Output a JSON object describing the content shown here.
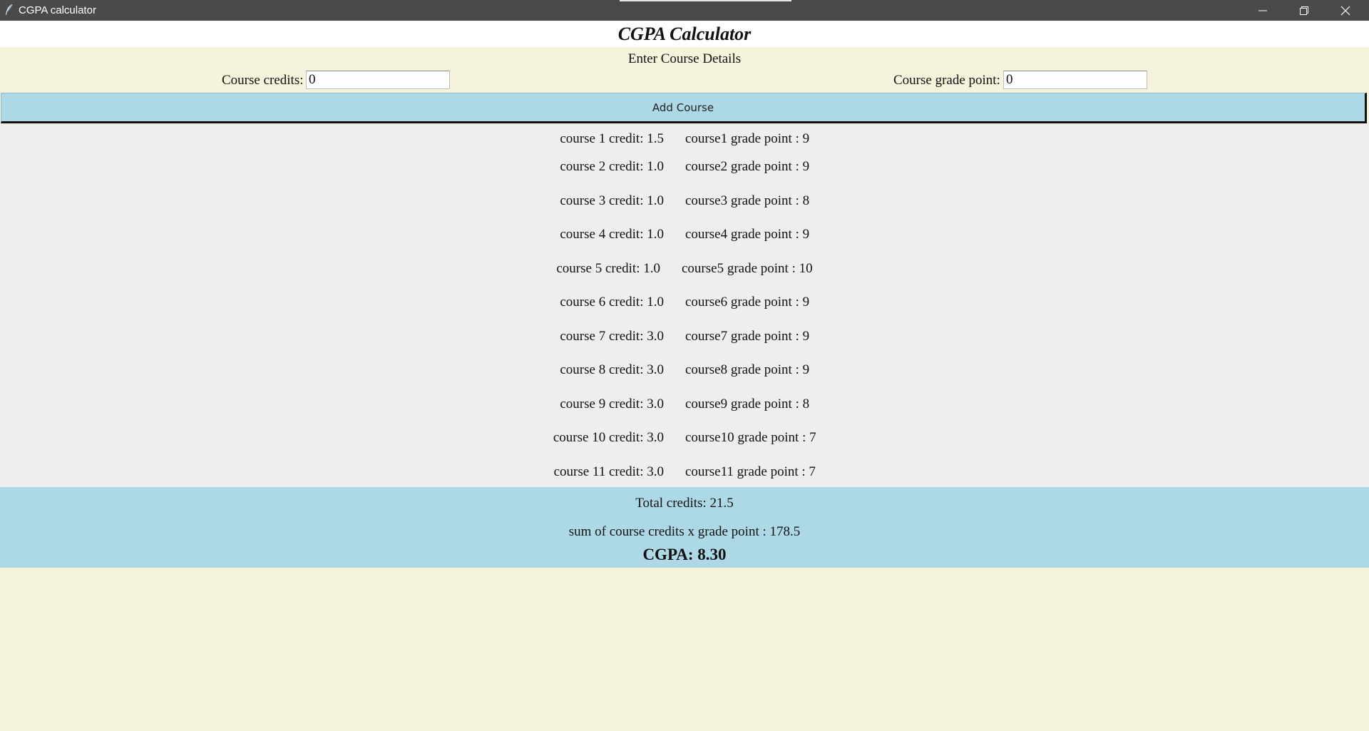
{
  "window": {
    "title": "CGPA calculator"
  },
  "heading": "CGPA Calculator",
  "form": {
    "section_label": "Enter Course Details",
    "credits_label": "Course credits:",
    "credits_value": "0",
    "grade_label": "Course grade point:",
    "grade_value": "0",
    "add_button": "Add Course"
  },
  "courses": [
    {
      "credit": "course 1 credit: 1.5",
      "grade": "course1 grade point : 9"
    },
    {
      "credit": "course 2 credit: 1.0",
      "grade": "course2 grade point : 9"
    },
    {
      "credit": "course 3 credit: 1.0",
      "grade": "course3 grade point : 8"
    },
    {
      "credit": "course 4 credit: 1.0",
      "grade": "course4 grade point : 9"
    },
    {
      "credit": "course 5 credit: 1.0",
      "grade": "course5 grade point : 10"
    },
    {
      "credit": "course 6 credit: 1.0",
      "grade": "course6 grade point : 9"
    },
    {
      "credit": "course 7 credit: 3.0",
      "grade": "course7 grade point : 9"
    },
    {
      "credit": "course 8 credit: 3.0",
      "grade": "course8 grade point : 9"
    },
    {
      "credit": "course 9 credit: 3.0",
      "grade": "course9 grade point : 8"
    },
    {
      "credit": "course 10 credit: 3.0",
      "grade": "course10 grade point : 7"
    },
    {
      "credit": "course 11 credit: 3.0",
      "grade": "course11 grade point : 7"
    }
  ],
  "summary": {
    "total_credits": "Total credits: 21.5",
    "sum_products": "sum of  course credits x grade point : 178.5",
    "cgpa": "CGPA: 8.30"
  },
  "icons": {
    "app": "feather-icon",
    "minimize": "minimize-icon",
    "maximize": "restore-icon",
    "close": "close-icon"
  },
  "colors": {
    "titlebar": "#4a4a4a",
    "panel": "#f5f3dc",
    "accent": "#add8e6",
    "list_bg": "#eeeeee"
  }
}
